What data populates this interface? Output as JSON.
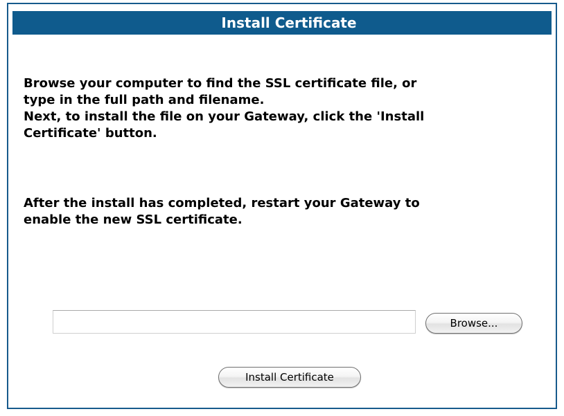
{
  "header": {
    "title": "Install Certificate"
  },
  "instructions": {
    "paragraph1_lines": [
      "Browse your computer to find the SSL certificate file, or",
      "type in the full path and filename.",
      "Next, to install the file on your Gateway, click the 'Install",
      "Certificate' button."
    ],
    "paragraph2_lines": [
      "After the install has completed, restart your Gateway to",
      "enable the new SSL certificate."
    ]
  },
  "file_picker": {
    "value": "",
    "browse_label": "Browse..."
  },
  "actions": {
    "install_label": "Install Certificate"
  },
  "colors": {
    "title_bar": "#0f5b8d",
    "panel_border": "#165a8c"
  }
}
